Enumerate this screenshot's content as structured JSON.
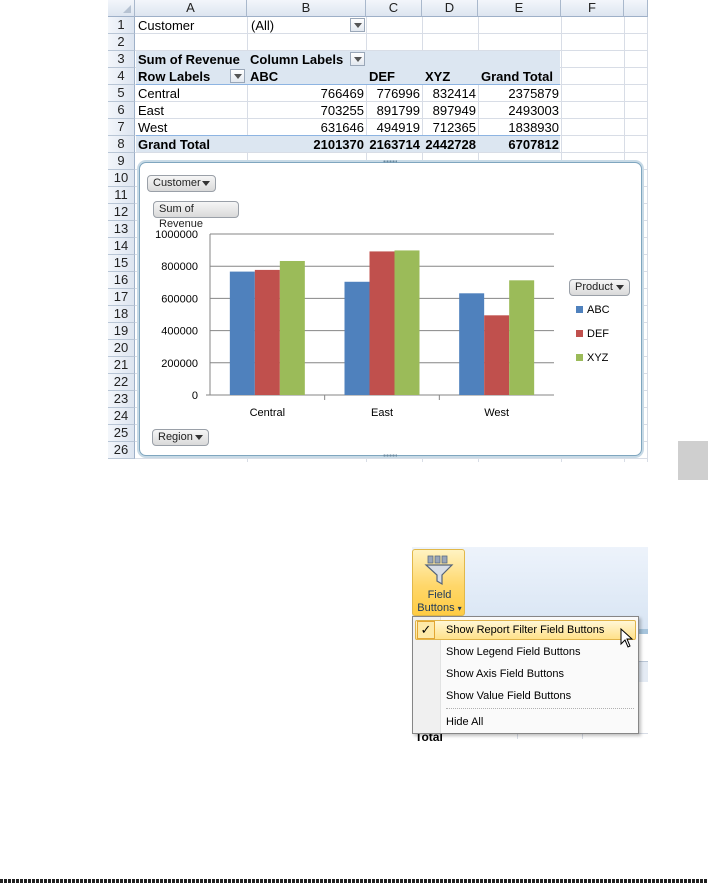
{
  "sheet": {
    "columns": [
      "A",
      "B",
      "C",
      "D",
      "E",
      "F"
    ],
    "rows": [
      "1",
      "2",
      "3",
      "4",
      "5",
      "6",
      "7",
      "8",
      "9",
      "10",
      "11",
      "12",
      "13",
      "14",
      "15",
      "16",
      "17",
      "18",
      "19",
      "20",
      "21",
      "22",
      "23",
      "24",
      "25",
      "26"
    ],
    "filter_label": "Customer",
    "filter_value": "(All)",
    "values_label": "Sum of Revenue",
    "column_labels": "Column Labels",
    "row_labels": "Row Labels",
    "col_heads": [
      "ABC",
      "DEF",
      "XYZ",
      "Grand Total"
    ],
    "data_rows": [
      {
        "label": "Central",
        "vals": [
          "766469",
          "776996",
          "832414",
          "2375879"
        ]
      },
      {
        "label": "East",
        "vals": [
          "703255",
          "891799",
          "897949",
          "2493003"
        ]
      },
      {
        "label": "West",
        "vals": [
          "631646",
          "494919",
          "712365",
          "1838930"
        ]
      }
    ],
    "grand_total": {
      "label": "Grand Total",
      "vals": [
        "2101370",
        "2163714",
        "2442728",
        "6707812"
      ]
    }
  },
  "chart_buttons": {
    "customer": "Customer",
    "sum_of_revenue": "Sum of Revenue",
    "product": "Product",
    "region": "Region"
  },
  "chart_data": {
    "type": "bar",
    "categories": [
      "Central",
      "East",
      "West"
    ],
    "series": [
      {
        "name": "ABC",
        "color": "#4f81bd",
        "values": [
          766469,
          703255,
          631646
        ]
      },
      {
        "name": "DEF",
        "color": "#c0504d",
        "values": [
          776996,
          891799,
          494919
        ]
      },
      {
        "name": "XYZ",
        "color": "#9bbb59",
        "values": [
          832414,
          897949,
          712365
        ]
      }
    ],
    "yticks": [
      "0",
      "200000",
      "400000",
      "600000",
      "800000",
      "1000000"
    ],
    "ylim": [
      0,
      1000000
    ],
    "grid": true,
    "legend": "right"
  },
  "ribbon": {
    "field_buttons_label": [
      "Field",
      "Buttons"
    ],
    "menu": [
      {
        "text": "Show Report Filter Field Buttons",
        "checked": true
      },
      {
        "text": "Show Legend Field Buttons",
        "checked": false
      },
      {
        "text": "Show Axis Field Buttons",
        "checked": false
      },
      {
        "text": "Show Value Field Buttons",
        "checked": false
      }
    ],
    "hide_all": "Hide All",
    "behind_text": "Total"
  }
}
